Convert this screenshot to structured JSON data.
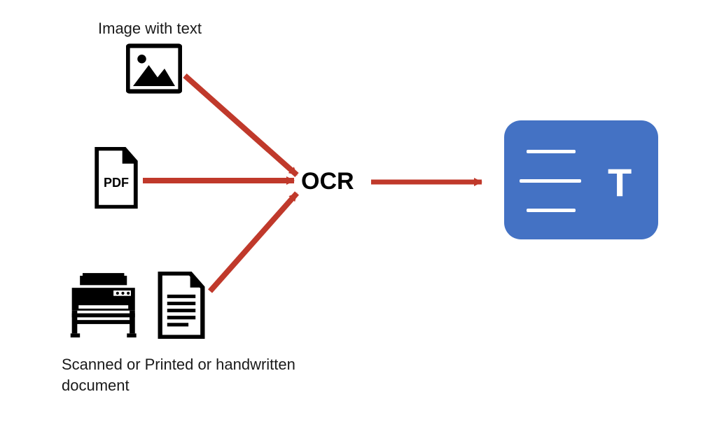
{
  "labels": {
    "image_with_text": "Image with text",
    "pdf": "PDF",
    "scanned_doc": "Scanned or Printed or handwritten document",
    "ocr": "OCR",
    "output_T": "T"
  },
  "colors": {
    "arrow": "#c0392b",
    "output_bg": "#4472c4",
    "output_fg": "#ffffff",
    "icon": "#000000"
  },
  "diagram": {
    "description": "Three document-source types (image with text, PDF, scanned/printed/handwritten document) each have a red arrow converging on a central OCR node, which has a red arrow pointing to a rounded blue output block containing text-line glyphs and a large T (representing extracted text).",
    "nodes": [
      {
        "id": "input_image",
        "kind": "input",
        "label_key": "labels.image_with_text"
      },
      {
        "id": "input_pdf",
        "kind": "input",
        "label_key": "labels.pdf"
      },
      {
        "id": "input_scanned",
        "kind": "input",
        "label_key": "labels.scanned_doc"
      },
      {
        "id": "ocr",
        "kind": "process",
        "label_key": "labels.ocr"
      },
      {
        "id": "output_text",
        "kind": "output",
        "label_key": "labels.output_T"
      }
    ],
    "edges": [
      {
        "from": "input_image",
        "to": "ocr"
      },
      {
        "from": "input_pdf",
        "to": "ocr"
      },
      {
        "from": "input_scanned",
        "to": "ocr"
      },
      {
        "from": "ocr",
        "to": "output_text"
      }
    ]
  }
}
